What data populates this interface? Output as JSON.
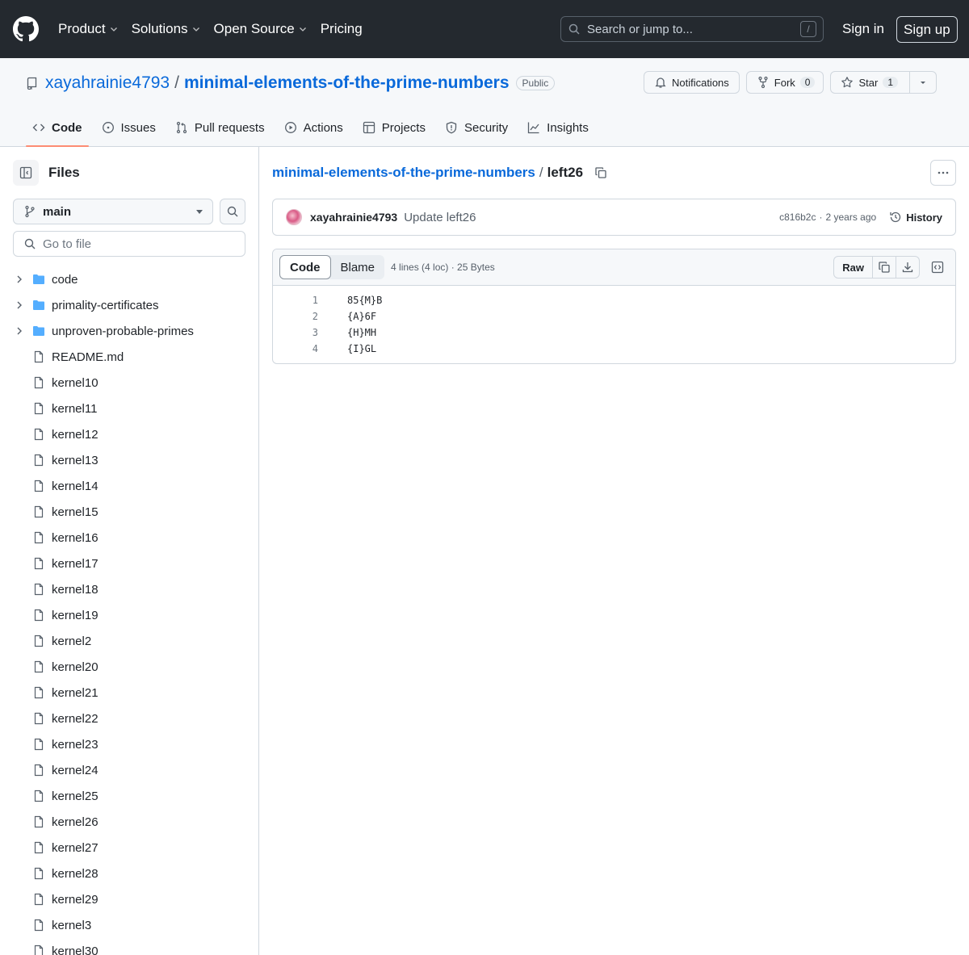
{
  "header": {
    "nav": [
      "Product",
      "Solutions",
      "Open Source",
      "Pricing"
    ],
    "search_placeholder": "Search or jump to...",
    "search_shortcut": "/",
    "signin": "Sign in",
    "signup": "Sign up"
  },
  "repo": {
    "owner": "xayahrainie4793",
    "separator": "/",
    "name": "minimal-elements-of-the-prime-numbers",
    "visibility": "Public",
    "notifications_label": "Notifications",
    "fork_label": "Fork",
    "fork_count": "0",
    "star_label": "Star",
    "star_count": "1"
  },
  "tabs": [
    {
      "label": "Code",
      "icon": "code-icon",
      "active": true
    },
    {
      "label": "Issues",
      "icon": "issue-icon"
    },
    {
      "label": "Pull requests",
      "icon": "pull-request-icon"
    },
    {
      "label": "Actions",
      "icon": "play-icon"
    },
    {
      "label": "Projects",
      "icon": "table-icon"
    },
    {
      "label": "Security",
      "icon": "shield-icon"
    },
    {
      "label": "Insights",
      "icon": "graph-icon"
    }
  ],
  "sidebar": {
    "title": "Files",
    "branch": "main",
    "goto_placeholder": "Go to file",
    "tree": [
      {
        "name": "code",
        "type": "dir"
      },
      {
        "name": "primality-certificates",
        "type": "dir"
      },
      {
        "name": "unproven-probable-primes",
        "type": "dir"
      },
      {
        "name": "README.md",
        "type": "file"
      },
      {
        "name": "kernel10",
        "type": "file"
      },
      {
        "name": "kernel11",
        "type": "file"
      },
      {
        "name": "kernel12",
        "type": "file"
      },
      {
        "name": "kernel13",
        "type": "file"
      },
      {
        "name": "kernel14",
        "type": "file"
      },
      {
        "name": "kernel15",
        "type": "file"
      },
      {
        "name": "kernel16",
        "type": "file"
      },
      {
        "name": "kernel17",
        "type": "file"
      },
      {
        "name": "kernel18",
        "type": "file"
      },
      {
        "name": "kernel19",
        "type": "file"
      },
      {
        "name": "kernel2",
        "type": "file"
      },
      {
        "name": "kernel20",
        "type": "file"
      },
      {
        "name": "kernel21",
        "type": "file"
      },
      {
        "name": "kernel22",
        "type": "file"
      },
      {
        "name": "kernel23",
        "type": "file"
      },
      {
        "name": "kernel24",
        "type": "file"
      },
      {
        "name": "kernel25",
        "type": "file"
      },
      {
        "name": "kernel26",
        "type": "file"
      },
      {
        "name": "kernel27",
        "type": "file"
      },
      {
        "name": "kernel28",
        "type": "file"
      },
      {
        "name": "kernel29",
        "type": "file"
      },
      {
        "name": "kernel3",
        "type": "file"
      },
      {
        "name": "kernel30",
        "type": "file"
      }
    ]
  },
  "breadcrumb": {
    "repo": "minimal-elements-of-the-prime-numbers",
    "separator": "/",
    "file": "left26"
  },
  "commit": {
    "author": "xayahrainie4793",
    "message": "Update left26",
    "sha": "c816b2c",
    "dot": "·",
    "time": "2 years ago",
    "history_label": "History"
  },
  "file": {
    "view_code": "Code",
    "view_blame": "Blame",
    "info": "4 lines (4 loc) · 25 Bytes",
    "raw_label": "Raw",
    "lines": [
      "85{M}B",
      "{A}6F",
      "{H}MH",
      "{I}GL"
    ]
  },
  "colors": {
    "header_bg": "#24292f",
    "link": "#0969da",
    "tab_underline": "#fd8c73",
    "folder": "#54aeff"
  }
}
